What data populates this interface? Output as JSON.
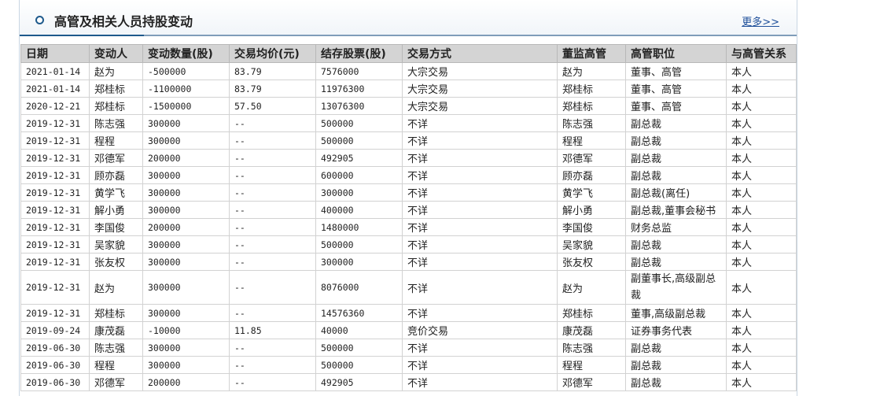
{
  "header": {
    "title": "高管及相关人员持股变动",
    "more": "更多>>"
  },
  "table": {
    "columns": [
      "日期",
      "变动人",
      "变动数量(股)",
      "交易均价(元)",
      "结存股票(股)",
      "交易方式",
      "董监高管",
      "高管职位",
      "与高管关系"
    ],
    "rows": [
      [
        "2021-01-14",
        "赵为",
        "-500000",
        "83.79",
        "7576000",
        "大宗交易",
        "赵为",
        "董事、高管",
        "本人"
      ],
      [
        "2021-01-14",
        "郑桂标",
        "-1100000",
        "83.79",
        "11976300",
        "大宗交易",
        "郑桂标",
        "董事、高管",
        "本人"
      ],
      [
        "2020-12-21",
        "郑桂标",
        "-1500000",
        "57.50",
        "13076300",
        "大宗交易",
        "郑桂标",
        "董事、高管",
        "本人"
      ],
      [
        "2019-12-31",
        "陈志强",
        "300000",
        "--",
        "500000",
        "不详",
        "陈志强",
        "副总裁",
        "本人"
      ],
      [
        "2019-12-31",
        "程程",
        "300000",
        "--",
        "500000",
        "不详",
        "程程",
        "副总裁",
        "本人"
      ],
      [
        "2019-12-31",
        "邓德军",
        "200000",
        "--",
        "492905",
        "不详",
        "邓德军",
        "副总裁",
        "本人"
      ],
      [
        "2019-12-31",
        "顾亦磊",
        "300000",
        "--",
        "600000",
        "不详",
        "顾亦磊",
        "副总裁",
        "本人"
      ],
      [
        "2019-12-31",
        "黄学飞",
        "300000",
        "--",
        "300000",
        "不详",
        "黄学飞",
        "副总裁(离任)",
        "本人"
      ],
      [
        "2019-12-31",
        "解小勇",
        "300000",
        "--",
        "400000",
        "不详",
        "解小勇",
        "副总裁,董事会秘书",
        "本人"
      ],
      [
        "2019-12-31",
        "李国俊",
        "200000",
        "--",
        "1480000",
        "不详",
        "李国俊",
        "财务总监",
        "本人"
      ],
      [
        "2019-12-31",
        "吴家貌",
        "300000",
        "--",
        "500000",
        "不详",
        "吴家貌",
        "副总裁",
        "本人"
      ],
      [
        "2019-12-31",
        "张友权",
        "300000",
        "--",
        "300000",
        "不详",
        "张友权",
        "副总裁",
        "本人"
      ],
      [
        "2019-12-31",
        "赵为",
        "300000",
        "--",
        "8076000",
        "不详",
        "赵为",
        "副董事长,高级副总裁",
        "本人"
      ],
      [
        "2019-12-31",
        "郑桂标",
        "300000",
        "--",
        "14576360",
        "不详",
        "郑桂标",
        "董事,高级副总裁",
        "本人"
      ],
      [
        "2019-09-24",
        "康茂磊",
        "-10000",
        "11.85",
        "40000",
        "竞价交易",
        "康茂磊",
        "证券事务代表",
        "本人"
      ],
      [
        "2019-06-30",
        "陈志强",
        "300000",
        "--",
        "500000",
        "不详",
        "陈志强",
        "副总裁",
        "本人"
      ],
      [
        "2019-06-30",
        "程程",
        "300000",
        "--",
        "500000",
        "不详",
        "程程",
        "副总裁",
        "本人"
      ],
      [
        "2019-06-30",
        "邓德军",
        "200000",
        "--",
        "492905",
        "不详",
        "邓德军",
        "副总裁",
        "本人"
      ]
    ]
  }
}
